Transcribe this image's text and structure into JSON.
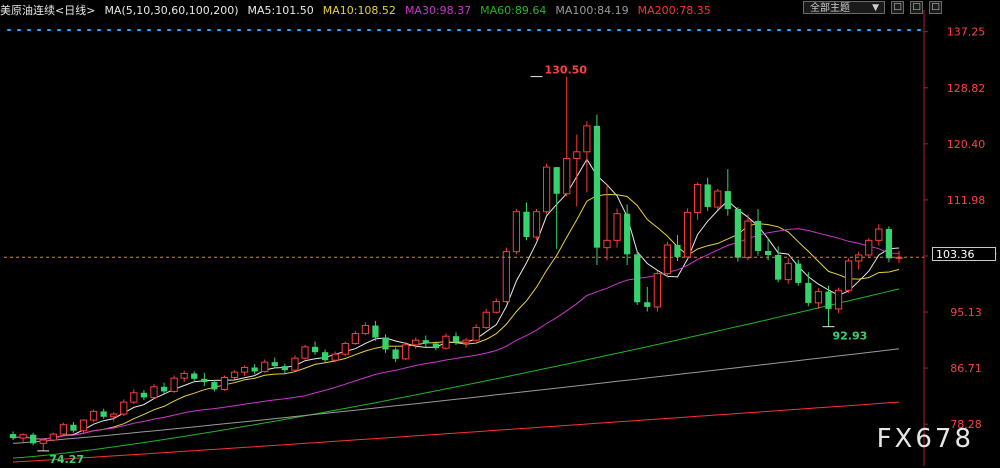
{
  "header": {
    "symbol": "美原油连续",
    "period": "<日线>",
    "ma_params": "MA(5,10,30,60,100,200)",
    "ma5": "MA5:101.50",
    "ma10": "MA10:108.52",
    "ma30": "MA30:98.37",
    "ma60": "MA60:89.64",
    "ma100": "MA100:84.19",
    "ma200": "MA200:78.35"
  },
  "toolbar": {
    "theme_label": "全部主题",
    "theme_arrow": "▼",
    "btn1": "□",
    "btn2": "□",
    "btn3": "□"
  },
  "watermark": "FX678",
  "last_price_label": "103.36",
  "colors": {
    "up": "#ff3b3b",
    "down": "#36d26e",
    "ma5": "#e8e8e8",
    "ma10": "#e6d23a",
    "ma30": "#cc35cc",
    "ma60": "#20b520",
    "ma100": "#9a9a9a",
    "ma200": "#ff3030",
    "axis_text": "#ff4040",
    "dotted_line": "#2da8ff",
    "last_price_line": "#d98a1a"
  },
  "chart_data": {
    "type": "candlestick",
    "y_ticks": [
      "137.25",
      "128.82",
      "120.40",
      "111.98",
      "103.55",
      "95.13",
      "86.71",
      "78.28"
    ],
    "ylim": [
      72.0,
      139.0
    ],
    "current_price": 103.36,
    "annotations": [
      {
        "text": "130.50",
        "value": 130.5,
        "index": 52
      },
      {
        "text": "92.93",
        "value": 92.93,
        "index": 81
      },
      {
        "text": "74.27",
        "value": 74.27,
        "index": 3
      }
    ],
    "candles": [
      [
        76.8,
        77.2,
        75.9,
        76.2
      ],
      [
        76.2,
        76.9,
        75.6,
        76.7
      ],
      [
        76.7,
        77.0,
        75.1,
        75.4
      ],
      [
        75.4,
        76.2,
        74.27,
        75.9
      ],
      [
        75.9,
        77.0,
        75.7,
        76.8
      ],
      [
        76.8,
        78.5,
        76.6,
        78.2
      ],
      [
        78.2,
        78.6,
        77.0,
        77.3
      ],
      [
        77.3,
        79.0,
        77.0,
        78.9
      ],
      [
        78.9,
        80.5,
        78.6,
        80.2
      ],
      [
        80.2,
        80.6,
        79.1,
        79.4
      ],
      [
        79.4,
        80.1,
        78.7,
        79.8
      ],
      [
        79.8,
        82.0,
        79.5,
        81.6
      ],
      [
        81.6,
        83.5,
        81.3,
        83.0
      ],
      [
        83.0,
        83.4,
        81.9,
        82.3
      ],
      [
        82.3,
        84.3,
        82.1,
        83.9
      ],
      [
        83.9,
        84.5,
        82.8,
        83.2
      ],
      [
        83.2,
        85.6,
        83.0,
        85.2
      ],
      [
        85.2,
        86.3,
        84.6,
        85.9
      ],
      [
        85.9,
        86.2,
        84.8,
        85.1
      ],
      [
        85.1,
        86.0,
        84.0,
        84.6
      ],
      [
        84.6,
        84.9,
        83.2,
        83.5
      ],
      [
        83.5,
        85.6,
        83.3,
        85.3
      ],
      [
        85.3,
        86.4,
        85.0,
        86.1
      ],
      [
        86.1,
        87.1,
        85.5,
        86.8
      ],
      [
        86.8,
        87.3,
        85.8,
        86.2
      ],
      [
        86.2,
        88.0,
        86.0,
        87.6
      ],
      [
        87.6,
        88.3,
        86.7,
        87.0
      ],
      [
        87.0,
        87.4,
        85.9,
        86.4
      ],
      [
        86.4,
        88.6,
        86.2,
        88.2
      ],
      [
        88.2,
        90.2,
        88.0,
        89.9
      ],
      [
        89.9,
        90.7,
        88.7,
        89.1
      ],
      [
        89.1,
        89.5,
        87.5,
        87.9
      ],
      [
        87.9,
        89.2,
        87.6,
        88.8
      ],
      [
        88.8,
        90.7,
        88.5,
        90.4
      ],
      [
        90.4,
        92.3,
        90.2,
        91.9
      ],
      [
        91.9,
        93.6,
        91.7,
        93.1
      ],
      [
        93.1,
        93.8,
        90.8,
        91.3
      ],
      [
        91.3,
        91.8,
        89.0,
        89.5
      ],
      [
        89.5,
        89.8,
        87.6,
        88.1
      ],
      [
        88.1,
        90.6,
        87.9,
        90.2
      ],
      [
        90.2,
        91.3,
        89.6,
        90.9
      ],
      [
        90.9,
        91.6,
        89.8,
        90.4
      ],
      [
        90.4,
        90.7,
        89.4,
        89.7
      ],
      [
        89.7,
        91.9,
        89.5,
        91.5
      ],
      [
        91.5,
        92.1,
        90.2,
        90.6
      ],
      [
        90.6,
        91.2,
        89.8,
        90.9
      ],
      [
        90.9,
        93.3,
        90.7,
        92.8
      ],
      [
        92.8,
        95.6,
        92.6,
        95.1
      ],
      [
        95.1,
        97.2,
        94.9,
        96.7
      ],
      [
        96.7,
        104.8,
        96.5,
        104.2
      ],
      [
        104.2,
        110.6,
        103.8,
        110.2
      ],
      [
        110.2,
        111.6,
        105.9,
        106.4
      ],
      [
        106.4,
        110.6,
        106.0,
        110.2
      ],
      [
        110.2,
        117.4,
        109.8,
        116.9
      ],
      [
        116.9,
        116.9,
        104.6,
        112.9
      ],
      [
        112.9,
        130.5,
        112.5,
        118.2
      ],
      [
        118.2,
        121.8,
        111.0,
        119.2
      ],
      [
        119.2,
        123.8,
        113.1,
        123.1
      ],
      [
        123.1,
        124.8,
        102.2,
        104.8
      ],
      [
        104.8,
        114.2,
        102.9,
        105.9
      ],
      [
        105.9,
        110.7,
        104.8,
        109.9
      ],
      [
        109.9,
        111.3,
        102.2,
        103.8
      ],
      [
        103.8,
        104.4,
        96.2,
        96.6
      ],
      [
        96.6,
        98.9,
        95.2,
        95.9
      ],
      [
        95.9,
        101.3,
        95.2,
        100.9
      ],
      [
        100.9,
        105.7,
        100.3,
        105.2
      ],
      [
        105.2,
        106.7,
        102.8,
        103.4
      ],
      [
        103.4,
        110.7,
        103.1,
        110.1
      ],
      [
        110.1,
        114.6,
        109.0,
        114.3
      ],
      [
        114.3,
        115.3,
        110.3,
        110.9
      ],
      [
        110.9,
        113.6,
        110.5,
        113.3
      ],
      [
        113.3,
        116.6,
        109.6,
        110.6
      ],
      [
        110.6,
        110.9,
        102.7,
        103.3
      ],
      [
        103.3,
        109.8,
        102.9,
        108.8
      ],
      [
        108.8,
        110.6,
        103.6,
        104.3
      ],
      [
        104.3,
        106.3,
        102.9,
        103.7
      ],
      [
        103.7,
        105.0,
        99.6,
        100.0
      ],
      [
        100.0,
        103.2,
        99.4,
        102.4
      ],
      [
        102.4,
        103.0,
        99.1,
        99.5
      ],
      [
        99.5,
        101.1,
        96.0,
        96.5
      ],
      [
        96.5,
        98.7,
        95.6,
        98.2
      ],
      [
        98.2,
        99.1,
        92.93,
        95.6
      ],
      [
        95.6,
        98.8,
        95.0,
        98.4
      ],
      [
        98.4,
        103.2,
        98.0,
        102.8
      ],
      [
        102.8,
        104.2,
        101.5,
        103.7
      ],
      [
        103.7,
        106.2,
        103.4,
        105.9
      ],
      [
        105.9,
        108.3,
        105.1,
        107.6
      ],
      [
        107.6,
        108.0,
        102.6,
        103.2
      ],
      [
        103.2,
        104.3,
        102.5,
        103.36
      ]
    ]
  }
}
